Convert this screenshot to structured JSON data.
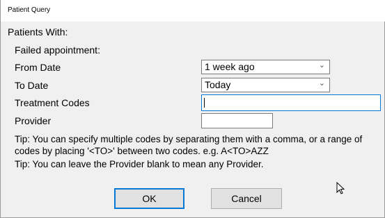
{
  "window": {
    "title": "Patient Query"
  },
  "form": {
    "section_label": "Patients With:",
    "criterion_label": "Failed appointment:",
    "from_date": {
      "label": "From Date",
      "value": "1 week ago"
    },
    "to_date": {
      "label": "To Date",
      "value": "Today"
    },
    "treatment_codes": {
      "label": "Treatment Codes",
      "value": ""
    },
    "provider": {
      "label": "Provider",
      "value": ""
    }
  },
  "tips": {
    "tip1": "Tip: You can specify multiple codes by separating them with a comma, or a range of codes by placing '<TO>' between two codes. e.g. A<TO>AZZ",
    "tip2": "Tip: You can leave the Provider blank to mean any Provider."
  },
  "buttons": {
    "ok": "OK",
    "cancel": "Cancel"
  },
  "colors": {
    "focus_border": "#0078d7",
    "button_face": "#e1e1e1",
    "dialog_bg": "#f0f0f0"
  },
  "icons": {
    "combo": "chevron-down-icon",
    "cursor": "mouse-pointer-icon"
  }
}
